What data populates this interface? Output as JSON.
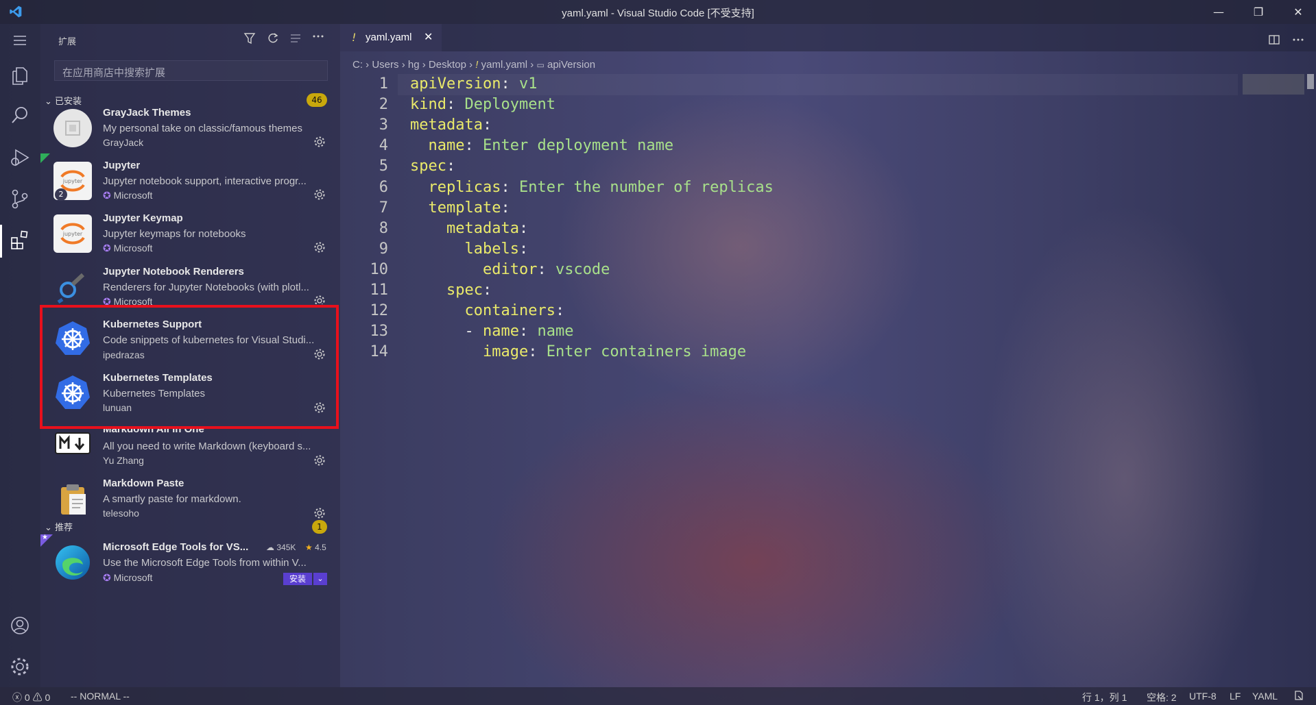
{
  "window": {
    "title": "yaml.yaml - Visual Studio Code [不受支持]",
    "minimize": "—",
    "restore": "❐",
    "close": "✕"
  },
  "sidebar": {
    "title": "扩展",
    "search_placeholder": "在应用商店中搜索扩展",
    "installed_label": "已安装",
    "installed_count": "46",
    "recommended_label": "推荐",
    "recommended_count": "1",
    "installed": [
      {
        "name": "GrayJack Themes",
        "desc": "My personal take on classic/famous themes",
        "publisher": "GrayJack"
      },
      {
        "name": "Jupyter",
        "desc": "Jupyter notebook support, interactive progr...",
        "publisher": "Microsoft",
        "badge": "2"
      },
      {
        "name": "Jupyter Keymap",
        "desc": "Jupyter keymaps for notebooks",
        "publisher": "Microsoft"
      },
      {
        "name": "Jupyter Notebook Renderers",
        "desc": "Renderers for Jupyter Notebooks (with plotl...",
        "publisher": "Microsoft"
      },
      {
        "name": "Kubernetes Support",
        "desc": "Code snippets of kubernetes for Visual Studi...",
        "publisher": "ipedrazas"
      },
      {
        "name": "Kubernetes Templates",
        "desc": "Kubernetes Templates",
        "publisher": "lunuan"
      },
      {
        "name": "Markdown All in One",
        "desc": "All you need to write Markdown (keyboard s...",
        "publisher": "Yu Zhang"
      },
      {
        "name": "Markdown Paste",
        "desc": "A smartly paste for markdown.",
        "publisher": "telesoho"
      }
    ],
    "recommended": [
      {
        "name": "Microsoft Edge Tools for VS...",
        "desc": "Use the Microsoft Edge Tools from within V...",
        "publisher": "Microsoft",
        "downloads": "345K",
        "rating": "4.5",
        "install_label": "安装"
      }
    ]
  },
  "editor": {
    "tab_label": "yaml.yaml",
    "tab_modified": "!",
    "breadcrumb": [
      "C:",
      "Users",
      "hg",
      "Desktop",
      "yaml.yaml",
      "apiVersion"
    ],
    "lines": [
      {
        "n": "1",
        "indent": "",
        "dash": "",
        "key": "apiVersion",
        "value": "v1"
      },
      {
        "n": "2",
        "indent": "",
        "dash": "",
        "key": "kind",
        "value": "Deployment"
      },
      {
        "n": "3",
        "indent": "",
        "dash": "",
        "key": "metadata",
        "value": ""
      },
      {
        "n": "4",
        "indent": "  ",
        "dash": "",
        "key": "name",
        "value": "Enter deployment name"
      },
      {
        "n": "5",
        "indent": "",
        "dash": "",
        "key": "spec",
        "value": ""
      },
      {
        "n": "6",
        "indent": "  ",
        "dash": "",
        "key": "replicas",
        "value": "Enter the number of replicas"
      },
      {
        "n": "7",
        "indent": "  ",
        "dash": "",
        "key": "template",
        "value": ""
      },
      {
        "n": "8",
        "indent": "    ",
        "dash": "",
        "key": "metadata",
        "value": ""
      },
      {
        "n": "9",
        "indent": "      ",
        "dash": "",
        "key": "labels",
        "value": ""
      },
      {
        "n": "10",
        "indent": "        ",
        "dash": "",
        "key": "editor",
        "value": "vscode"
      },
      {
        "n": "11",
        "indent": "    ",
        "dash": "",
        "key": "spec",
        "value": ""
      },
      {
        "n": "12",
        "indent": "      ",
        "dash": "",
        "key": "containers",
        "value": ""
      },
      {
        "n": "13",
        "indent": "      ",
        "dash": "- ",
        "key": "name",
        "value": "name"
      },
      {
        "n": "14",
        "indent": "        ",
        "dash": "",
        "key": "image",
        "value": "Enter containers image"
      }
    ]
  },
  "status": {
    "errors": "0",
    "warnings": "0",
    "mode": "-- NORMAL --",
    "position": "行 1，列 1",
    "spaces": "空格: 2",
    "encoding": "UTF-8",
    "eol": "LF",
    "language": "YAML"
  },
  "colors": {
    "highlight_border": "#e8101c",
    "yaml_key": "#eaea6a",
    "yaml_value": "#a8e08a",
    "badge": "#c9a80c"
  }
}
